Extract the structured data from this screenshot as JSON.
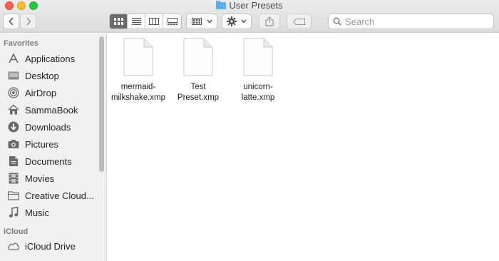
{
  "window": {
    "title": "User Presets"
  },
  "toolbar": {
    "search_placeholder": "Search"
  },
  "sidebar": {
    "favorites_header": "Favorites",
    "favorites": [
      {
        "label": "Applications",
        "icon": "applications-icon"
      },
      {
        "label": "Desktop",
        "icon": "desktop-icon"
      },
      {
        "label": "AirDrop",
        "icon": "airdrop-icon"
      },
      {
        "label": "SammaBook",
        "icon": "home-icon"
      },
      {
        "label": "Downloads",
        "icon": "downloads-icon"
      },
      {
        "label": "Pictures",
        "icon": "camera-icon"
      },
      {
        "label": "Documents",
        "icon": "document-icon"
      },
      {
        "label": "Movies",
        "icon": "film-icon"
      },
      {
        "label": "Creative Cloud...",
        "icon": "folder-icon"
      },
      {
        "label": "Music",
        "icon": "music-note-icon"
      }
    ],
    "icloud_header": "iCloud",
    "icloud": [
      {
        "label": "iCloud Drive",
        "icon": "cloud-icon"
      }
    ]
  },
  "files": [
    {
      "line1": "mermaid-",
      "line2": "milkshake.xmp"
    },
    {
      "line1": "Test",
      "line2": "Preset.xmp"
    },
    {
      "line1": "unicorn-",
      "line2": "latte.xmp"
    }
  ],
  "colors": {
    "view_active": "#6b6b6b",
    "folder_blue": "#5ab0f0",
    "sidebar_bg": "#f1f1f1"
  }
}
